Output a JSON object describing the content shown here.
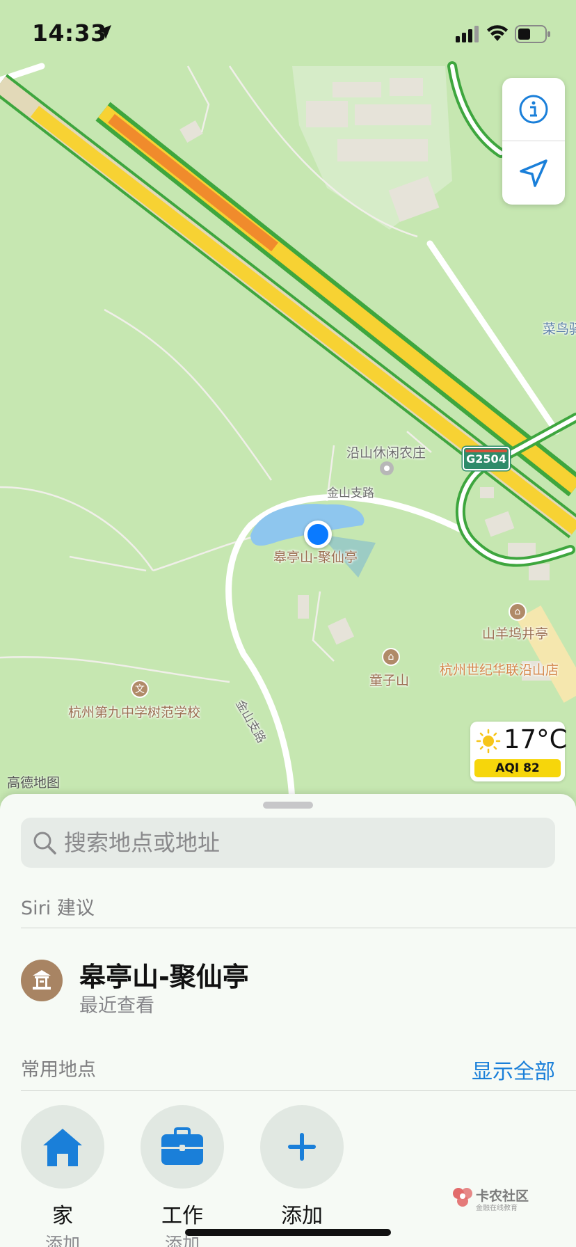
{
  "status_bar": {
    "time": "14:33"
  },
  "map": {
    "labels": {
      "cainiao": "菜鸟驿",
      "yanshan_farm": "沿山休闲农庄",
      "jinshan_road_top": "金山支路",
      "gaoting": "皋亭山-聚仙亭",
      "shanyangwu": "山羊坞井亭",
      "hangzhou_shop": "杭州世纪华联沿山店",
      "tongzishan": "童子山",
      "jinshan_road_side": "金山支路",
      "school": "杭州第九中学树范学校"
    },
    "road_shield": "G2504",
    "attribution": "高德地图"
  },
  "weather": {
    "temperature": "17°C",
    "aqi": "AQI 82"
  },
  "sheet": {
    "search_placeholder": "搜索地点或地址",
    "siri_section_title": "Siri 建议",
    "suggestion": {
      "title": "皋亭山-聚仙亭",
      "subtitle": "最近查看"
    },
    "favorites_section_title": "常用地点",
    "show_all_label": "显示全部",
    "favorites": [
      {
        "label": "家",
        "sub": "添加",
        "icon": "house-icon"
      },
      {
        "label": "工作",
        "sub": "添加",
        "icon": "briefcase-icon"
      },
      {
        "label": "添加",
        "icon": "plus-icon"
      }
    ]
  },
  "watermark": {
    "brand": "卡农社区",
    "tagline": "金融在线教育"
  },
  "colors": {
    "accent_blue": "#1a7fd9",
    "user_location": "#0a7aff",
    "aqi_yellow": "#f6d60b"
  }
}
